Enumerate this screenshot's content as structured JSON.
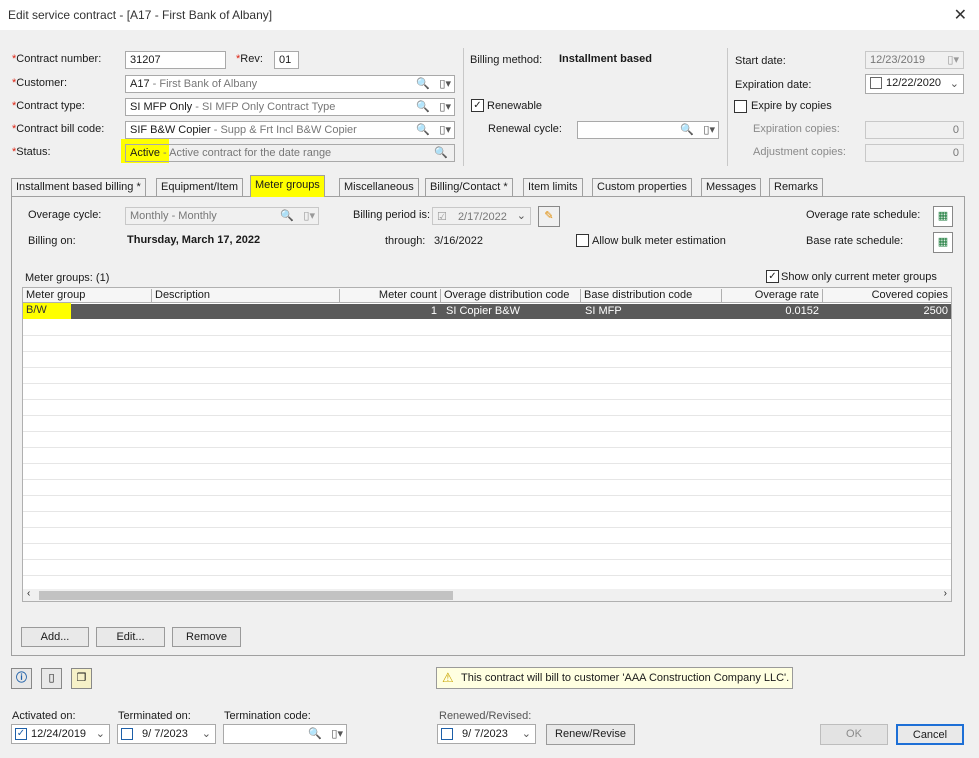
{
  "window": {
    "title": "Edit service contract - [A17 - First Bank of Albany]",
    "close_icon": "close-icon"
  },
  "header": {
    "contract_number_label": "Contract number:",
    "contract_number": "31207",
    "rev_label": "Rev:",
    "rev": "01",
    "customer_label": "Customer:",
    "customer_code": "A17",
    "customer_name": "- First Bank of Albany",
    "contract_type_label": "Contract type:",
    "contract_type_code": "SI MFP Only",
    "contract_type_name": "- SI MFP Only Contract Type",
    "bill_code_label": "Contract bill code:",
    "bill_code_code": "SIF B&W Copier",
    "bill_code_name": "- Supp & Frt Incl B&W Copier",
    "status_label": "Status:",
    "status_code": "Active",
    "status_name": "- Active contract for the date range",
    "required_mark": "*"
  },
  "billing": {
    "method_label": "Billing method:",
    "method_value": "Installment based",
    "renewable_label": "Renewable",
    "renewal_cycle_label": "Renewal cycle:"
  },
  "dates": {
    "start_label": "Start date:",
    "start_value": "12/23/2019",
    "expiration_label": "Expiration date:",
    "expiration_value": "12/22/2020",
    "expire_by_copies_label": "Expire by copies",
    "expiration_copies_label": "Expiration copies:",
    "expiration_copies_value": "0",
    "adjustment_copies_label": "Adjustment copies:",
    "adjustment_copies_value": "0"
  },
  "tabs": [
    {
      "label": "Installment based billing *"
    },
    {
      "label": "Equipment/Item"
    },
    {
      "label": "Meter groups"
    },
    {
      "label": "Miscellaneous"
    },
    {
      "label": "Billing/Contact *"
    },
    {
      "label": "Item limits"
    },
    {
      "label": "Custom properties"
    },
    {
      "label": "Messages"
    },
    {
      "label": "Remarks"
    }
  ],
  "meter": {
    "overage_cycle_label": "Overage cycle:",
    "overage_cycle_value": "Monthly - Monthly",
    "billing_period_label": "Billing period is:",
    "billing_period_value": "2/17/2022",
    "overage_rate_label": "Overage rate schedule:",
    "billing_on_label": "Billing on:",
    "billing_on_value": "Thursday, March 17, 2022",
    "through_label": "through:",
    "through_value": "3/16/2022",
    "bulk_label": "Allow bulk meter estimation",
    "base_rate_label": "Base rate schedule:",
    "groups_count_label": "Meter groups: (1)",
    "show_current_label": "Show only current meter groups"
  },
  "grid": {
    "columns": [
      "Meter group",
      "Description",
      "Meter count",
      "Overage distribution code",
      "Base distribution code",
      "Overage rate",
      "Covered copies"
    ],
    "rows": [
      [
        "B/W",
        "",
        "1",
        "SI Copier B&W",
        "SI MFP",
        "0.0152",
        "2500"
      ]
    ]
  },
  "buttons": {
    "add": "Add...",
    "edit": "Edit...",
    "remove": "Remove",
    "renew": "Renew/Revise",
    "ok": "OK",
    "cancel": "Cancel"
  },
  "notice": "This contract will bill to customer 'AAA Construction Company LLC'.",
  "footer": {
    "activated_label": "Activated on:",
    "activated_value": "12/24/2019",
    "terminated_label": "Terminated on:",
    "terminated_value": "9/ 7/2023",
    "termination_code_label": "Termination code:",
    "renewed_label": "Renewed/Revised:",
    "renewed_value": "9/ 7/2023"
  }
}
